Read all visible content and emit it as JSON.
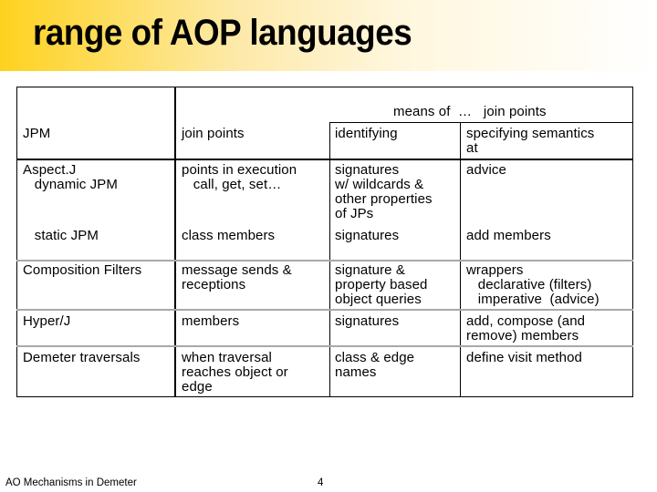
{
  "slide": {
    "title": "range of AOP languages",
    "footer_text": "AO Mechanisms in Demeter",
    "page_number": "4",
    "accent_color": "#ffd21f"
  },
  "table": {
    "header": {
      "group_label": "means of  …   join points",
      "columns": [
        "JPM",
        "join points",
        "identifying",
        "specifying semantics\nat"
      ]
    },
    "rows": [
      {
        "jpm": "Aspect.J\n   dynamic JPM",
        "join_points": "points in execution\n   call, get, set…",
        "identifying": "signatures\nw/ wildcards &\nother properties\nof JPs",
        "semantics": "advice"
      },
      {
        "jpm": "   static JPM",
        "join_points": "class members",
        "identifying": "signatures",
        "semantics": "add members"
      },
      {
        "jpm": "Composition Filters",
        "join_points": "message sends &\nreceptions",
        "identifying": "signature &\nproperty based\nobject queries",
        "semantics": "wrappers\n   declarative (filters)\n   imperative  (advice)"
      },
      {
        "jpm": "Hyper/J",
        "join_points": "members",
        "identifying": "signatures",
        "semantics": "add, compose (and\nremove) members"
      },
      {
        "jpm": "Demeter traversals",
        "join_points": "when traversal\nreaches object or\nedge",
        "identifying": "class & edge\nnames",
        "semantics": "define visit method"
      }
    ]
  }
}
